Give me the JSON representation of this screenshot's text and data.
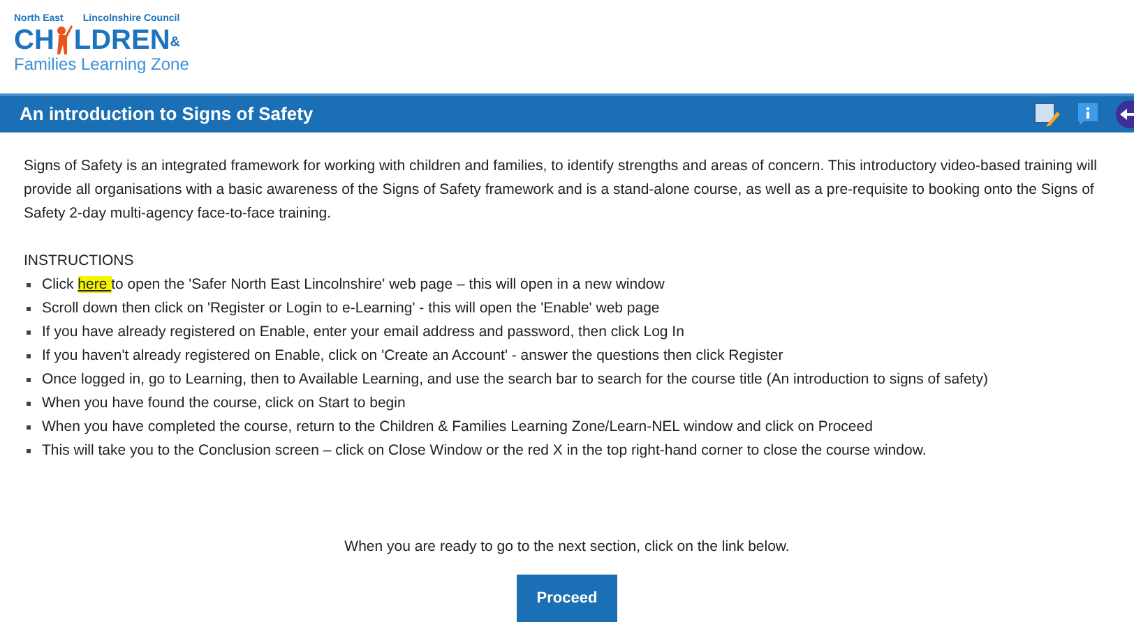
{
  "logo": {
    "top_left": "North East",
    "top_right": "Lincolnshire Council",
    "word_start": "CH",
    "word_end": "LDREN",
    "ampersand": "&",
    "subtitle": "Families Learning Zone"
  },
  "header": {
    "title": "An introduction to Signs of Safety"
  },
  "intro": "Signs of Safety is an integrated framework for working with children and families, to identify strengths and areas of concern. This introductory video-based training will provide all organisations with a basic awareness of the Signs of Safety framework and is a stand-alone course, as well as a pre-requisite to booking onto the Signs of Safety 2-day multi-agency face-to-face training.",
  "instructions_heading": "INSTRUCTIONS",
  "instructions": [
    {
      "before": "Click ",
      "link": "here ",
      "after": "to open the 'Safer North East Lincolnshire' web page – this will open in a new window"
    },
    {
      "before": "Scroll down then click on 'Register or Login to e-Learning' - this will open the 'Enable' web page"
    },
    {
      "before": "If you have already registered on Enable, enter your email address and password, then click Log In"
    },
    {
      "before": "If you haven't already registered on Enable, click on 'Create an Account' - answer the questions then click Register"
    },
    {
      "before": "Once logged in, go to Learning, then to Available Learning, and use the search bar to search for the course title (An introduction to signs of safety)"
    },
    {
      "before": "When you have found the course, click on Start to begin"
    },
    {
      "before": "When you have completed the course, return to the Children & Families Learning Zone/Learn-NEL window and click on Proceed"
    },
    {
      "before": "This will take you to the Conclusion screen – click on Close Window or the red X in the top right-hand corner to close the course window."
    }
  ],
  "next_prompt": "When you are ready to go to the next section, click on the link below.",
  "proceed_button": "Proceed"
}
